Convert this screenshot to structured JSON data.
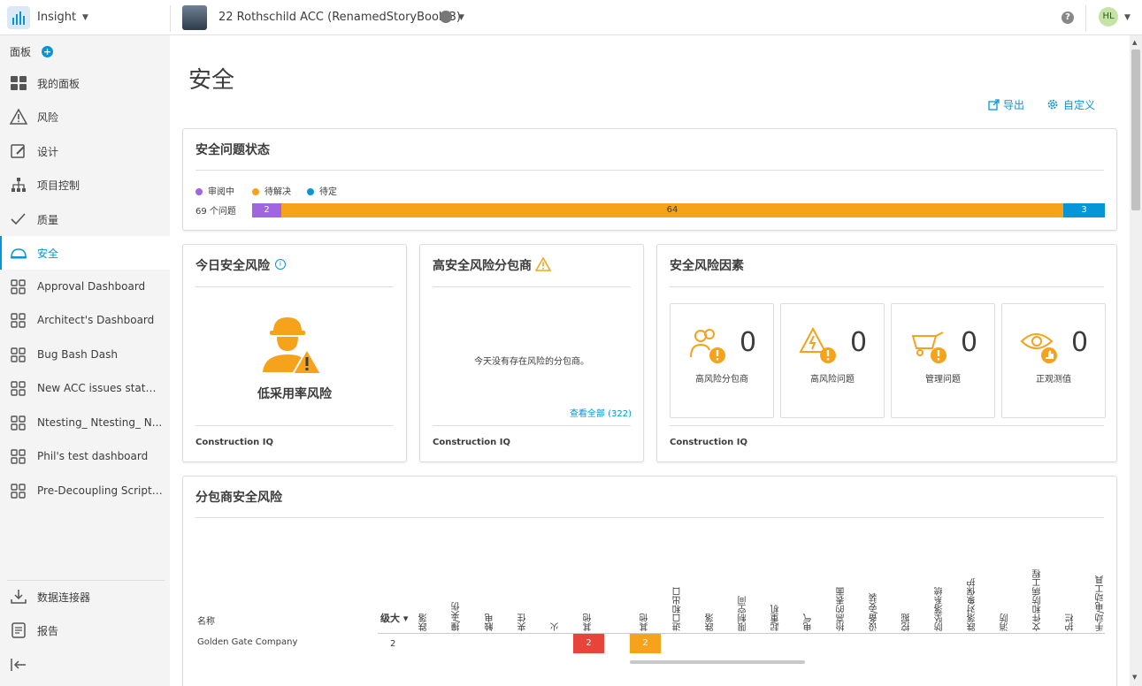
{
  "topbar": {
    "app_name": "Insight",
    "project_name": "22 Rothschild ACC (RenamedStoryBook 3)",
    "help": "?",
    "user_initials": "HL"
  },
  "sidebar": {
    "header": "面板",
    "items": [
      {
        "label": "我的面板",
        "icon": "grid-dashboard-icon"
      },
      {
        "label": "风险",
        "icon": "warning-triangle-icon"
      },
      {
        "label": "设计",
        "icon": "edit-pencil-icon"
      },
      {
        "label": "项目控制",
        "icon": "hierarchy-icon"
      },
      {
        "label": "质量",
        "icon": "checkmark-icon"
      },
      {
        "label": "安全",
        "icon": "hardhat-icon"
      },
      {
        "label": "Approval Dashboard",
        "icon": "dashboard-grid-icon"
      },
      {
        "label": "Architect's Dashboard",
        "icon": "dashboard-grid-icon"
      },
      {
        "label": "Bug Bash Dash",
        "icon": "dashboard-grid-icon"
      },
      {
        "label": "New ACC issues status...",
        "icon": "dashboard-grid-icon"
      },
      {
        "label": "Ntesting_ Ntesting_ N...",
        "icon": "dashboard-grid-icon"
      },
      {
        "label": "Phil's test dashboard",
        "icon": "dashboard-grid-icon"
      },
      {
        "label": "Pre-Decoupling Script ...",
        "icon": "dashboard-grid-icon"
      }
    ],
    "bottom": [
      {
        "label": "数据连接器",
        "icon": "download-icon"
      },
      {
        "label": "报告",
        "icon": "report-icon"
      }
    ]
  },
  "page": {
    "title": "安全",
    "export_label": "导出",
    "customize_label": "自定义"
  },
  "status_card": {
    "title": "安全问题状态",
    "legend": [
      {
        "label": "审阅中",
        "color": "#a066e0"
      },
      {
        "label": "待解决",
        "color": "#f7a21b"
      },
      {
        "label": "待定",
        "color": "#0696d7"
      }
    ],
    "issue_count": "69 个问题",
    "segments": [
      {
        "value": 2,
        "color": "#a066e0"
      },
      {
        "value": 64,
        "color": "#f7a21b"
      },
      {
        "value": 3,
        "color": "#0696d7"
      }
    ]
  },
  "today_card": {
    "title": "今日安全风险",
    "risk_label": "低采用率风险",
    "footer": "Construction IQ"
  },
  "sub_card": {
    "title": "高安全风险分包商",
    "empty_text": "今天没有存在风险的分包商。",
    "view_all": "查看全部 (322)",
    "footer": "Construction IQ"
  },
  "factors_card": {
    "title": "安全风险因素",
    "factors": [
      {
        "value": "0",
        "label": "高风险分包商"
      },
      {
        "value": "0",
        "label": "高风险问题"
      },
      {
        "value": "0",
        "label": "管理问题"
      },
      {
        "value": "0",
        "label": "正观测值"
      }
    ],
    "footer": "Construction IQ"
  },
  "sub_risk_card": {
    "title": "分包商安全风险",
    "name_header": "名称",
    "sort_header": "级大",
    "columns": [
      "跌落",
      "撞/夹伤",
      "触电",
      "夹住",
      "火",
      "其他",
      "其他",
      "进口和出口",
      "跌落",
      "限制空间",
      "起重机",
      "电气",
      "抬高的表面",
      "设备/安装",
      "挖掘",
      "防坠落系统",
      "跌落对象保护",
      "消防",
      "文件和防病工程",
      "护栏",
      "手动/电动工具"
    ],
    "rows": [
      {
        "name": "Golden Gate Company",
        "total": "2",
        "cell_red": "2",
        "cell_orange": "2"
      }
    ]
  }
}
